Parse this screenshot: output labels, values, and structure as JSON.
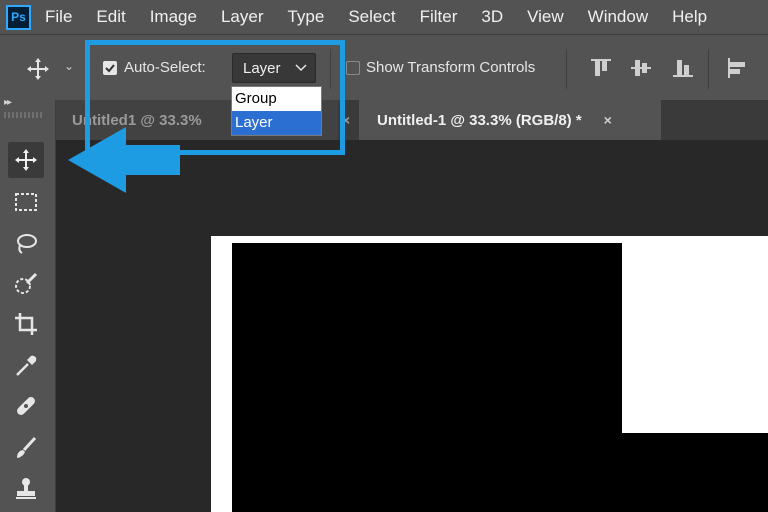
{
  "app": {
    "logo": "Ps"
  },
  "menu": [
    "File",
    "Edit",
    "Image",
    "Layer",
    "Type",
    "Select",
    "Filter",
    "3D",
    "View",
    "Window",
    "Help"
  ],
  "options_bar": {
    "auto_select_label": "Auto-Select:",
    "auto_select_checked": true,
    "auto_select_target": "Layer",
    "show_transform_label": "Show Transform Controls",
    "show_transform_checked": false
  },
  "dropdown": {
    "options": [
      "Group",
      "Layer"
    ],
    "selected": "Layer"
  },
  "tabs": [
    {
      "label": "Untitled1 @ 33.3%",
      "active": false
    },
    {
      "label": "Untitled-1 @ 33.3% (RGB/8) *",
      "active": true
    }
  ],
  "tab_close_glyph": "×",
  "toolbar": {
    "tools": [
      "move-icon",
      "rectangular-marquee-icon",
      "lasso-icon",
      "quick-selection-icon",
      "crop-icon",
      "eyedropper-icon",
      "healing-brush-icon",
      "brush-icon",
      "clone-stamp-icon"
    ],
    "selected": "move-icon"
  },
  "colors": {
    "highlight": "#1d9be3",
    "dropdown_selected": "#2c6fd3",
    "ps_blue": "#31a8ff"
  }
}
